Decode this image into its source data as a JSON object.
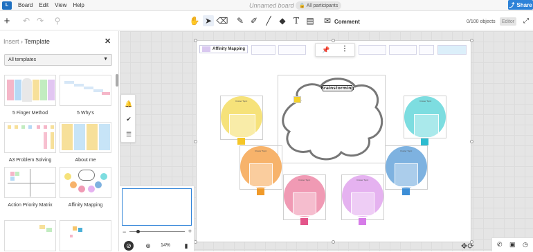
{
  "menubar": {
    "logo": "L",
    "items": [
      "Board",
      "Edit",
      "View",
      "Help"
    ],
    "board_title": "Unnamed board",
    "participants": "All participants",
    "share": "Share"
  },
  "toolbar": {
    "comment": "Comment",
    "object_count": "0/100 objects",
    "role": "Editor"
  },
  "sidebar": {
    "breadcrumb_parent": "Insert",
    "breadcrumb_sep": "›",
    "breadcrumb_current": "Template",
    "filter": "All templates",
    "templates": [
      {
        "label": "5 Finger Method"
      },
      {
        "label": "5 Why's"
      },
      {
        "label": "A3 Problem Solving"
      },
      {
        "label": "About me"
      },
      {
        "label": "Action Priority Matrix"
      },
      {
        "label": "Affinity Mapping"
      },
      {
        "label": ""
      },
      {
        "label": ""
      }
    ]
  },
  "board": {
    "title": "Affinity Mapping",
    "brainstorm_title": "Brainstorming",
    "bubble_label": "Cluster Topic"
  },
  "minimap": {
    "zoom": "14%"
  },
  "colors": {
    "accent": "#2d82d8",
    "yellow": "#f6e27a",
    "teal": "#7ddde0",
    "orange": "#f7b36b",
    "blue": "#7eb2e0",
    "pink": "#f09ab4",
    "purple": "#e5b2f0"
  }
}
